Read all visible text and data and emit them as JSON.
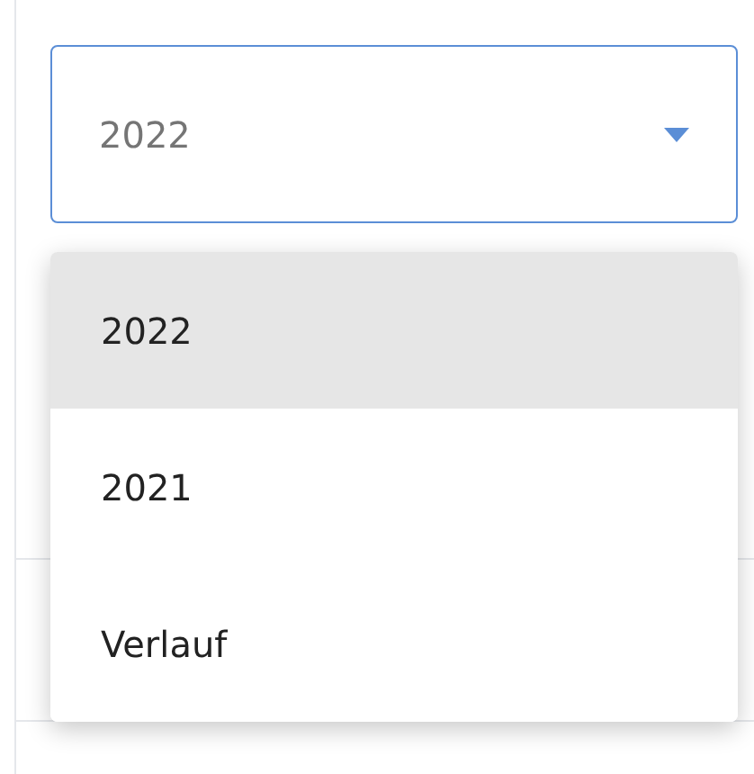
{
  "select": {
    "value": "2022",
    "expanded": true
  },
  "options": [
    {
      "label": "2022",
      "selected": true
    },
    {
      "label": "2021",
      "selected": false
    },
    {
      "label": "Verlauf",
      "selected": false
    }
  ]
}
